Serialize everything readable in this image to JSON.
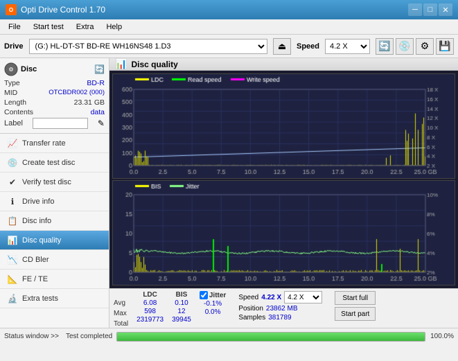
{
  "titleBar": {
    "title": "Opti Drive Control 1.70",
    "iconLabel": "O",
    "minBtn": "─",
    "maxBtn": "□",
    "closeBtn": "✕"
  },
  "menuBar": {
    "items": [
      "File",
      "Start test",
      "Extra",
      "Help"
    ]
  },
  "driveBar": {
    "label": "Drive",
    "driveValue": "(G:)  HL-DT-ST BD-RE  WH16NS48 1.D3",
    "speedLabel": "Speed",
    "speedValue": "4.2 X  ▼"
  },
  "disc": {
    "label": "Disc",
    "fields": [
      {
        "label": "Type",
        "value": "BD-R",
        "highlight": true
      },
      {
        "label": "MID",
        "value": "OTCBDR002 (000)",
        "highlight": true
      },
      {
        "label": "Length",
        "value": "23.31 GB",
        "highlight": false
      },
      {
        "label": "Contents",
        "value": "data",
        "highlight": true
      },
      {
        "label": "Label",
        "value": "",
        "highlight": false
      }
    ]
  },
  "navItems": [
    {
      "id": "transfer-rate",
      "label": "Transfer rate",
      "icon": "📈"
    },
    {
      "id": "create-test-disc",
      "label": "Create test disc",
      "icon": "💿"
    },
    {
      "id": "verify-test-disc",
      "label": "Verify test disc",
      "icon": "✔"
    },
    {
      "id": "drive-info",
      "label": "Drive info",
      "icon": "ℹ"
    },
    {
      "id": "disc-info",
      "label": "Disc info",
      "icon": "📋"
    },
    {
      "id": "disc-quality",
      "label": "Disc quality",
      "icon": "📊",
      "active": true
    },
    {
      "id": "cd-bler",
      "label": "CD Bler",
      "icon": "📉"
    },
    {
      "id": "fe-te",
      "label": "FE / TE",
      "icon": "📐"
    },
    {
      "id": "extra-tests",
      "label": "Extra tests",
      "icon": "🔬"
    }
  ],
  "contentHeader": {
    "title": "Disc quality"
  },
  "chart": {
    "topLegend": [
      "LDC",
      "Read speed",
      "Write speed"
    ],
    "bottomLegend": [
      "BIS",
      "Jitter"
    ],
    "topYMax": 600,
    "topYAxisLabels": [
      "18 X",
      "16 X",
      "14 X",
      "12 X",
      "10 X",
      "8 X",
      "6 X",
      "4 X",
      "2 X"
    ],
    "bottomYMax": 20,
    "bottomYAxisLabels": [
      "10%",
      "8%",
      "6%",
      "4%",
      "2%"
    ],
    "xAxisLabels": [
      "0.0",
      "2.5",
      "5.0",
      "7.5",
      "10.0",
      "12.5",
      "15.0",
      "17.5",
      "20.0",
      "22.5",
      "25.0 GB"
    ]
  },
  "stats": {
    "columns": [
      {
        "header": "LDC",
        "avg": "6.08",
        "max": "598",
        "total": "2319773"
      },
      {
        "header": "BIS",
        "avg": "0.10",
        "max": "12",
        "total": "39945"
      }
    ],
    "jitter": {
      "label": "Jitter",
      "avg": "-0.1%",
      "max": "0.0%",
      "total": ""
    },
    "speed": {
      "label": "Speed",
      "value": "4.22 X",
      "selectValue": "4.2 X  ▼"
    },
    "position": {
      "label": "Position",
      "value": "23862 MB"
    },
    "samples": {
      "label": "Samples",
      "value": "381789"
    },
    "startFull": "Start full",
    "startPart": "Start part",
    "rowLabels": [
      "Avg",
      "Max",
      "Total"
    ]
  },
  "bottomBar": {
    "statusWindowLabel": "Status window >>",
    "progressPercent": "100.0%",
    "testCompleted": "Test completed"
  }
}
